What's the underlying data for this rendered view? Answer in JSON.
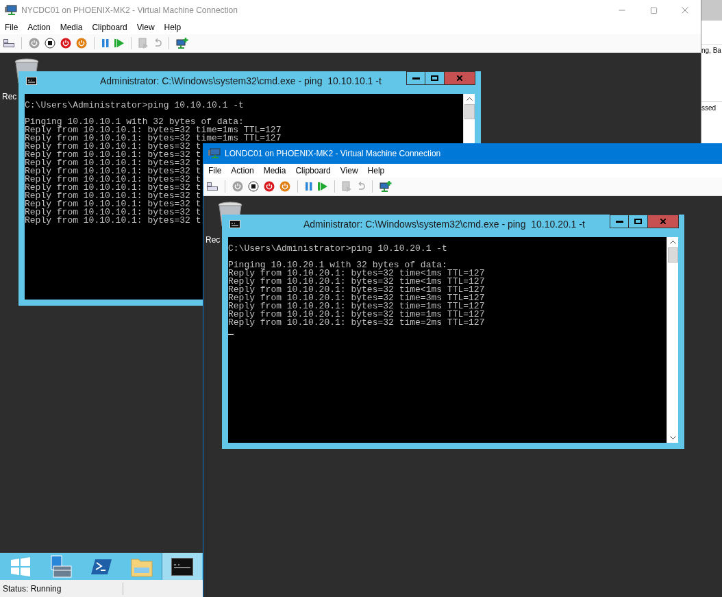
{
  "windows": [
    {
      "title": "NYCDC01 on PHOENIX-MK2 - Virtual Machine Connection",
      "active": false,
      "window_controls": true,
      "menu": [
        "File",
        "Action",
        "Media",
        "Clipboard",
        "View",
        "Help"
      ],
      "desktop": {
        "recycle_bin_label": "Rec",
        "console": {
          "title": "Administrator: C:\\Windows\\system32\\cmd.exe - ping  10.10.10.1 -t",
          "prompt": "C:\\Users\\Administrator>ping 10.10.10.1 -t",
          "cursor": false,
          "output": [
            "Pinging 10.10.10.1 with 32 bytes of data:",
            "Reply from 10.10.10.1: bytes=32 time=1ms TTL=127",
            "Reply from 10.10.10.1: bytes=32 time=1ms TTL=127",
            "Reply from 10.10.10.1: bytes=32 t",
            "Reply from 10.10.10.1: bytes=32 t",
            "Reply from 10.10.10.1: bytes=32 t",
            "Reply from 10.10.10.1: bytes=32 t",
            "Reply from 10.10.10.1: bytes=32 t",
            "Reply from 10.10.10.1: bytes=32 t",
            "Reply from 10.10.10.1: bytes=32 t",
            "Reply from 10.10.10.1: bytes=32 t",
            "Reply from 10.10.10.1: bytes=32 t",
            "Reply from 10.10.10.1: bytes=32 t"
          ]
        },
        "taskbar": [
          {
            "kind": "start",
            "selected": false
          },
          {
            "kind": "server",
            "selected": false
          },
          {
            "kind": "powershell",
            "selected": false
          },
          {
            "kind": "explorer",
            "selected": false
          },
          {
            "kind": "cmd",
            "selected": true
          }
        ]
      },
      "status": "Status: Running"
    },
    {
      "title": "LONDC01 on PHOENIX-MK2 - Virtual Machine Connection",
      "active": true,
      "window_controls": false,
      "menu": [
        "File",
        "Action",
        "Media",
        "Clipboard",
        "View",
        "Help"
      ],
      "desktop": {
        "recycle_bin_label": "Rec",
        "console": {
          "title": "Administrator: C:\\Windows\\system32\\cmd.exe - ping  10.10.20.1 -t",
          "prompt": "C:\\Users\\Administrator>ping 10.10.20.1 -t",
          "cursor": true,
          "output": [
            "Pinging 10.10.20.1 with 32 bytes of data:",
            "Reply from 10.10.20.1: bytes=32 time<1ms TTL=127",
            "Reply from 10.10.20.1: bytes=32 time<1ms TTL=127",
            "Reply from 10.10.20.1: bytes=32 time<1ms TTL=127",
            "Reply from 10.10.20.1: bytes=32 time=3ms TTL=127",
            "Reply from 10.10.20.1: bytes=32 time=1ms TTL=127",
            "Reply from 10.10.20.1: bytes=32 time=1ms TTL=127",
            "Reply from 10.10.20.1: bytes=32 time=2ms TTL=127"
          ]
        }
      }
    }
  ],
  "side_window": {
    "texts": [
      "ng, Ba",
      "ssed"
    ]
  }
}
